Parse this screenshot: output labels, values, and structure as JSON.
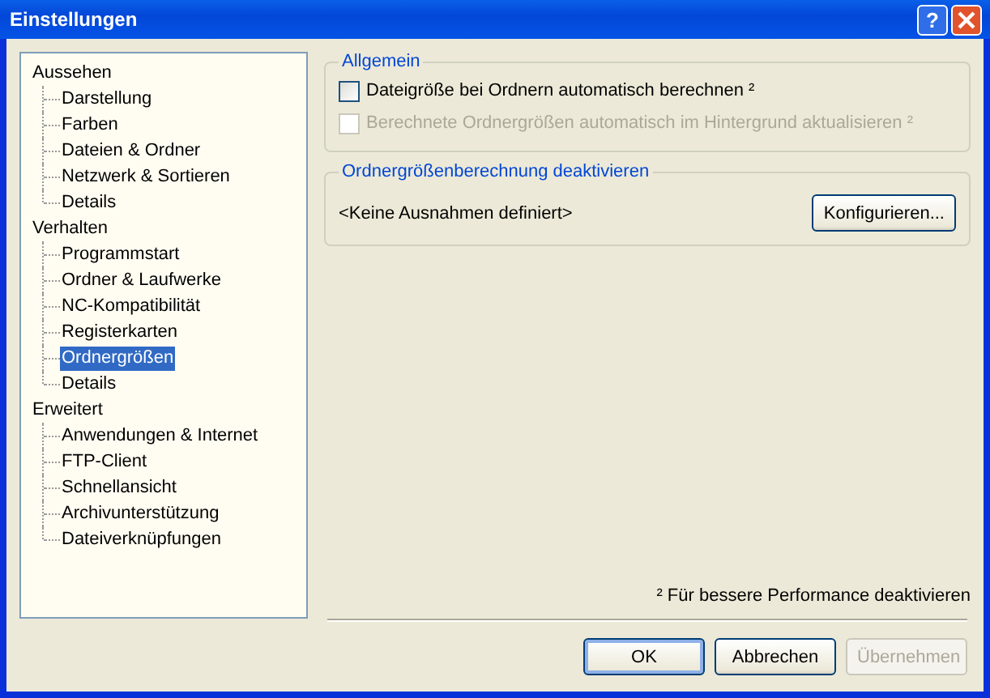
{
  "window": {
    "title": "Einstellungen",
    "help_label": "?"
  },
  "tree": [
    {
      "label": "Aussehen",
      "selected": false,
      "children": [
        {
          "label": "Darstellung",
          "selected": false
        },
        {
          "label": "Farben",
          "selected": false
        },
        {
          "label": "Dateien & Ordner",
          "selected": false
        },
        {
          "label": "Netzwerk & Sortieren",
          "selected": false
        },
        {
          "label": "Details",
          "selected": false
        }
      ]
    },
    {
      "label": "Verhalten",
      "selected": false,
      "children": [
        {
          "label": "Programmstart",
          "selected": false
        },
        {
          "label": "Ordner & Laufwerke",
          "selected": false
        },
        {
          "label": "NC-Kompatibilität",
          "selected": false
        },
        {
          "label": "Registerkarten",
          "selected": false
        },
        {
          "label": "Ordnergrößen",
          "selected": true
        },
        {
          "label": "Details",
          "selected": false
        }
      ]
    },
    {
      "label": "Erweitert",
      "selected": false,
      "children": [
        {
          "label": "Anwendungen & Internet",
          "selected": false
        },
        {
          "label": "FTP-Client",
          "selected": false
        },
        {
          "label": "Schnellansicht",
          "selected": false
        },
        {
          "label": "Archivunterstützung",
          "selected": false
        },
        {
          "label": "Dateiverknüpfungen",
          "selected": false
        }
      ]
    }
  ],
  "general": {
    "title": "Allgemein",
    "options": [
      {
        "label": "Dateigröße bei Ordnern automatisch berechnen ²",
        "checked": false,
        "disabled": false
      },
      {
        "label": "Berechnete Ordnergrößen automatisch im Hintergrund aktualisieren ²",
        "checked": false,
        "disabled": true
      }
    ]
  },
  "exclusions": {
    "title": "Ordnergrößenberechnung deaktivieren",
    "text": "<Keine Ausnahmen definiert>",
    "button": "Konfigurieren..."
  },
  "footnote": "² Für bessere Performance deaktivieren",
  "buttons": [
    {
      "label": "OK",
      "default": true,
      "disabled": false
    },
    {
      "label": "Abbrechen",
      "default": false,
      "disabled": false
    },
    {
      "label": "Übernehmen",
      "default": false,
      "disabled": true
    }
  ]
}
